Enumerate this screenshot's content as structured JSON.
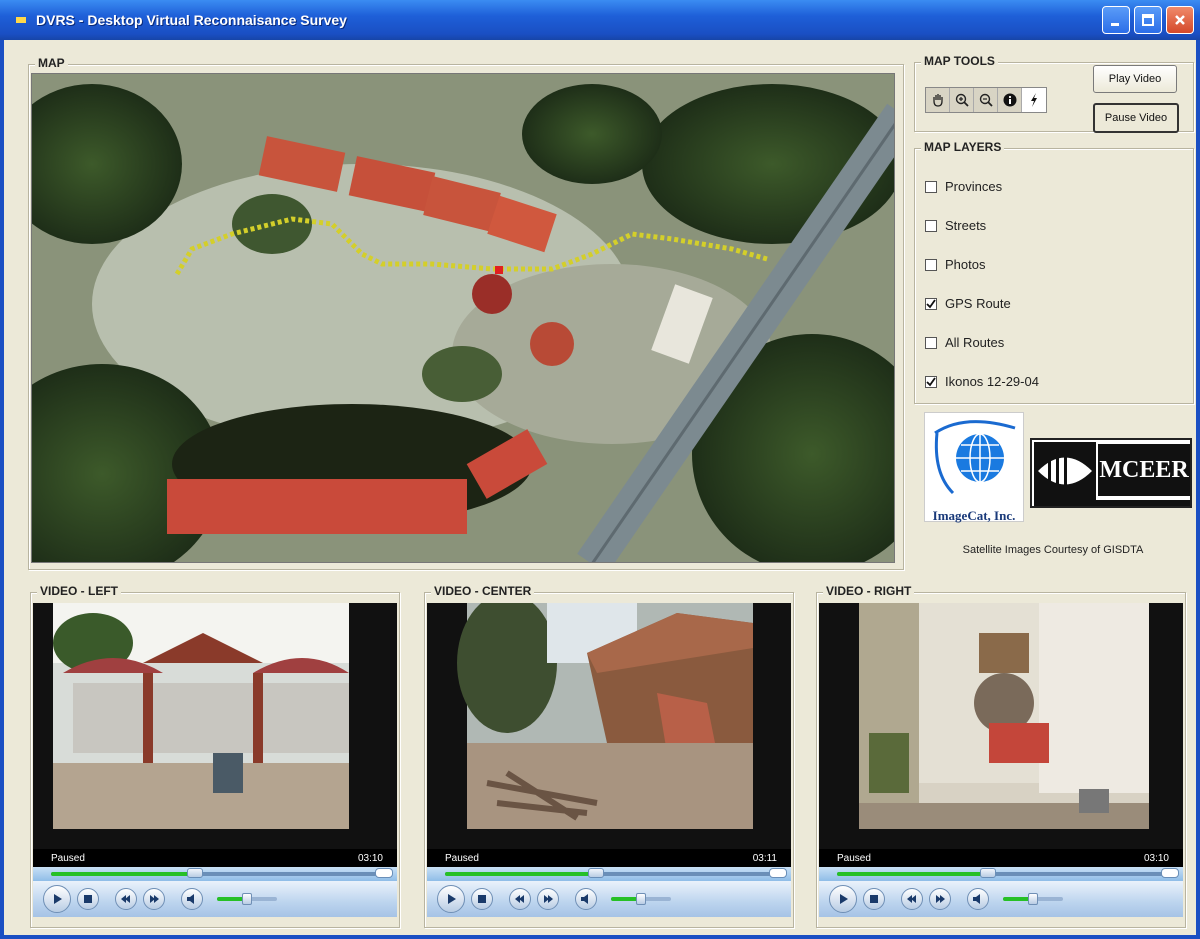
{
  "window": {
    "title": "DVRS - Desktop Virtual Reconnaisance Survey"
  },
  "map": {
    "label": "MAP"
  },
  "map_tools": {
    "label": "MAP TOOLS",
    "tools": [
      {
        "icon": "pan-hand-icon"
      },
      {
        "icon": "zoom-in-icon"
      },
      {
        "icon": "zoom-out-icon"
      },
      {
        "icon": "info-icon"
      },
      {
        "icon": "lightning-icon"
      }
    ],
    "play_label": "Play Video",
    "pause_label": "Pause Video"
  },
  "map_layers": {
    "label": "MAP LAYERS",
    "items": [
      {
        "label": "Provinces",
        "checked": false
      },
      {
        "label": "Streets",
        "checked": false
      },
      {
        "label": "Photos",
        "checked": false
      },
      {
        "label": "GPS Route",
        "checked": true
      },
      {
        "label": "All Routes",
        "checked": false
      },
      {
        "label": "Ikonos 12-29-04",
        "checked": true
      }
    ]
  },
  "logos": {
    "imagecat": "ImageCat, Inc.",
    "mceer": "MCEER",
    "credit": "Satellite Images Courtesy of GISDTA"
  },
  "videos": [
    {
      "label": "VIDEO - LEFT",
      "status": "Paused",
      "time": "03:10",
      "progress": 0.43,
      "volume": 0.5
    },
    {
      "label": "VIDEO - CENTER",
      "status": "Paused",
      "time": "03:11",
      "progress": 0.45,
      "volume": 0.5
    },
    {
      "label": "VIDEO - RIGHT",
      "status": "Paused",
      "time": "03:10",
      "progress": 0.45,
      "volume": 0.5
    }
  ]
}
